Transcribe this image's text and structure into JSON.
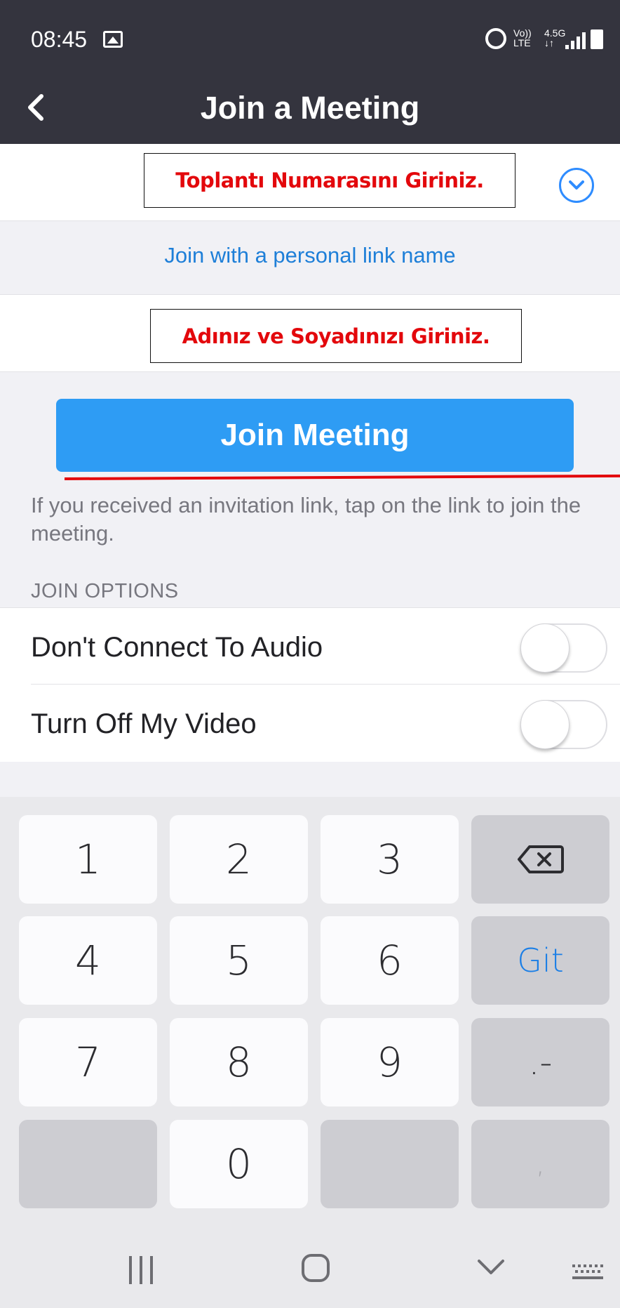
{
  "status_bar": {
    "time": "08:45",
    "volte_top": "Vo))",
    "volte_bottom": "LTE",
    "network_top": "4.5G",
    "network_bottom": "↓↑",
    "icons": [
      "image-icon",
      "alarm-icon",
      "signal-icon",
      "battery-icon"
    ]
  },
  "header": {
    "title": "Join a Meeting",
    "back_icon": "chevron-left-icon"
  },
  "form": {
    "meeting_id_placeholder": "Toplantı Numarasını Giriniz.",
    "personal_link": "Join with a personal link name",
    "name_placeholder": "Adınız ve Soyadınızı Giriniz."
  },
  "join_button": "Join Meeting",
  "help_text": "If you received an invitation link, tap on the link to join the meeting.",
  "options": {
    "header": "JOIN OPTIONS",
    "items": [
      {
        "label": "Don't Connect To Audio",
        "on": false
      },
      {
        "label": "Turn Off My Video",
        "on": false
      }
    ]
  },
  "keyboard": {
    "keys": [
      "1",
      "2",
      "3",
      "4",
      "5",
      "6",
      "Git",
      "7",
      "8",
      "9",
      ".-",
      "0",
      ","
    ]
  },
  "colors": {
    "header_bg": "#34343e",
    "accent_blue": "#2e9cf4",
    "link_blue": "#1e7fd8",
    "annotation_red": "#e3080c",
    "page_gray": "#f1f1f5"
  }
}
